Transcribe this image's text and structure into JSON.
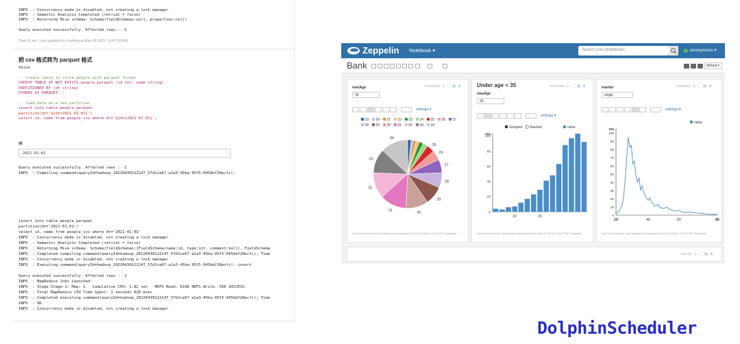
{
  "left": {
    "top_log": [
      "INFO  : Concurrency mode is disabled, not creating a lock manager",
      "INFO  : Semantic Analysis Completed (retrial = false)",
      "INFO  : Returning Hive schema: Schema(fieldSchemas:null, properties:null)"
    ],
    "top_result": "Query executed successfully. Affected rows : -1",
    "top_meta": "Took 11 sec. Last updated by chufeng at May 05 2022, 10:47:26 AM.",
    "para_title": "把 csv 格式转为 parquet 格式",
    "code_lines": [
      "%hive",
      "",
      "-- create table to store people with parquet format",
      "CREATE TABLE IF NOT EXISTS people_parquet (id int, name string)",
      "PARTITIONED BY (dt string)",
      "STORED AS PARQUET;",
      "",
      "-- load data as a new partition",
      "insert into table people_parquet",
      "partition(dt='${dt=2021-01-01}')",
      "select id, name from people_csv where dt='${dt=2021-01-01}';"
    ],
    "dt_label": "dt",
    "dt_value": "2021-01-01",
    "mid_log": [
      "Query executed successfully. Affected rows : -1",
      "INFO  : Compiling command(queryId=hadoop_20220430122147_57d1ce67-a1a3-45ba-95f5-045bbf28ecfc):"
    ],
    "bottom_log": [
      "insert into table people_parquet",
      "partition(dt='2021-01-01')",
      "select id, name from people_csv where dt='2021-01-01'",
      "INFO  : Concurrency mode is disabled, not creating a lock manager",
      "INFO  : Semantic Analysis Completed (retrial = false)",
      "INFO  : Returning Hive schema: Schema(fieldSchemas:[FieldSchema(name:id, type:int, comment:null), FieldSchema",
      "INFO  : Completed compiling command(queryId=hadoop_20220430122147_57d1ce67-a1a3-45ba-95f5-045bbf28ecfc); Time",
      "INFO  : Concurrency mode is disabled, not creating a lock manager",
      "INFO  : Executing command(queryId=hadoop_20220430122147_57d1ce67-a1a3-45ba-95f5-045bbf28ecfc): insert",
      "",
      "Query executed successfully. Affected rows : -1",
      "INFO  : MapReduce Jobs Launched:",
      "INFO  : Stage-Stage-1: Map: 1   Cumulative CPU: 1.82 sec   HDFS Read: 6198 HDFS Write: 566 SUCCESS",
      "INFO  : Total MapReduce CPU Time Spent: 1 seconds 820 msec",
      "INFO  : Completed executing command(queryId=hadoop_20220430122147_57d1ce67-a1a3-45ba-95f5-045bbf28ecfc); Time",
      "INFO  : OK",
      "INFO  : Concurrency mode is disabled, not creating a lock manager"
    ]
  },
  "zeppelin": {
    "brand": "Zeppelin",
    "menu_notebook": "Notebook ▾",
    "search_placeholder": "Search your Notebooks",
    "user": "anonymous ▾",
    "notebook_title": "Bank",
    "default_label": "default ▾",
    "colors": {
      "nav": "#3071a9",
      "bar": "#4a8ec9",
      "line": "#4a8ec9",
      "status_ok": "#5cb85c"
    },
    "para1": {
      "input_label": "maxAge",
      "input_value": "35",
      "status": "FINISHED",
      "settings": "settings ▾",
      "footer": "Took a few seconds. Last updated by anonymous at June 30 2016, 4:46:53 PM. (outdated)"
    },
    "para2": {
      "title": "Under age < 35",
      "input_label": "maxAge",
      "input_value": "30",
      "status": "FINISHED",
      "settings": "settings ▾",
      "legend_grouped": "Grouped",
      "legend_stacked": "Stacked",
      "legend_value": "value",
      "footer": "Took a few seconds. Last updated by anonymous at June 30 2016, 4:47:02 PM. (outdated)"
    },
    "para3": {
      "input_label": "marital",
      "input_value": "single",
      "status": "FINISHED",
      "settings": "settings ▾",
      "legend_value": "value",
      "footer": "Took a few seconds. Last updated by anonymous at June 30 2016, 4:47:06 PM. (outdated)"
    },
    "para4": {
      "status": "READY"
    }
  },
  "footer_brand": "DolphinScheduler",
  "chart_data": [
    {
      "type": "pie",
      "title": "",
      "categories": [
        "19",
        "20",
        "21",
        "22",
        "23",
        "24",
        "25",
        "26",
        "27",
        "28",
        "29",
        "30",
        "31",
        "32",
        "33",
        "34"
      ],
      "values": [
        4,
        3,
        3,
        4,
        5,
        6,
        9,
        12,
        16,
        18,
        22,
        27,
        32,
        31,
        29,
        33
      ],
      "colors": [
        "#2e5ea8",
        "#a8c6e8",
        "#f08a2a",
        "#f6c289",
        "#2c9a2c",
        "#9fd98a",
        "#d62728",
        "#f39b9b",
        "#8e63bd",
        "#c8b5dd",
        "#8c564b",
        "#c9a198",
        "#e377c2",
        "#f4b7d8",
        "#7f7f7f",
        "#c7c7c7"
      ],
      "labels_shown": [
        "25",
        "27",
        "26",
        "28",
        "29",
        "30",
        "31",
        "32",
        "33",
        "34"
      ]
    },
    {
      "type": "bar",
      "title": "Under age < 35",
      "x_ticks": [
        "22",
        "26"
      ],
      "y_ticks": [
        "0",
        "20",
        "40",
        "60",
        "80",
        "100"
      ],
      "ylim": [
        0,
        103
      ],
      "y_max_label": "103",
      "categories": [
        "19",
        "20",
        "21",
        "22",
        "23",
        "24",
        "25",
        "26",
        "27",
        "28",
        "29",
        "30",
        "31",
        "32",
        "33"
      ],
      "values": [
        4,
        3,
        6,
        7,
        12,
        17,
        23,
        29,
        41,
        48,
        63,
        88,
        97,
        103,
        92
      ],
      "legend": [
        "Grouped",
        "Stacked",
        "value"
      ]
    },
    {
      "type": "line",
      "title": "",
      "x_ticks": [
        "19",
        "40",
        "60",
        "85"
      ],
      "y_ticks": [
        "0",
        "10",
        "20",
        "30",
        "40",
        "50",
        "60",
        "70",
        "80",
        "90",
        "100"
      ],
      "ylim": [
        0,
        105
      ],
      "y_max_label": "105",
      "x": [
        19,
        21,
        23,
        24,
        25,
        26,
        27,
        28,
        29,
        30,
        31,
        32,
        33,
        34,
        35,
        36,
        37,
        38,
        39,
        40,
        41,
        42,
        43,
        44,
        45,
        46,
        48,
        50,
        52,
        54,
        56,
        58,
        60,
        62,
        64,
        66,
        70,
        75,
        80,
        85
      ],
      "values": [
        2,
        5,
        12,
        22,
        45,
        70,
        95,
        82,
        85,
        62,
        66,
        48,
        40,
        46,
        30,
        36,
        28,
        24,
        20,
        18,
        21,
        16,
        14,
        12,
        11,
        13,
        9,
        8,
        10,
        7,
        6,
        5,
        6,
        4,
        3,
        4,
        3,
        2,
        1,
        1
      ],
      "legend": [
        "value"
      ]
    }
  ]
}
